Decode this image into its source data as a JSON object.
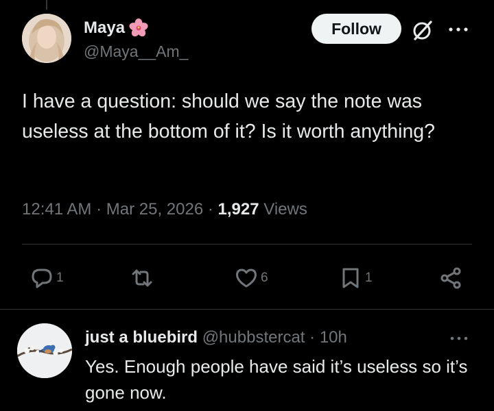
{
  "tweet": {
    "author": {
      "name": "Maya",
      "handle": "@Maya__Am_"
    },
    "follow_label": "Follow",
    "text": "I have a question: should we say the note was useless at the bottom of it? Is it worth anything?",
    "time": "12:41 AM",
    "date": "Mar 25, 2026",
    "separator": "·",
    "views_count": "1,927",
    "views_label": "Views",
    "actions": {
      "reply_count": "1",
      "like_count": "6",
      "bookmark_count": "1"
    }
  },
  "reply": {
    "author": {
      "name": "just a bluebird",
      "handle": "@hubbstercat"
    },
    "separator": "·",
    "time": "10h",
    "text": "Yes. Enough people have said it’s useless so it’s gone now."
  },
  "icons": {
    "name_emoji": "hibiscus-flower-icon",
    "grok": "grok-icon",
    "more": "more-icon",
    "reply": "reply-icon",
    "retweet": "retweet-icon",
    "like": "heart-icon",
    "bookmark": "bookmark-icon",
    "share": "share-icon"
  },
  "colors": {
    "background": "#000000",
    "primary_text": "#e7e9ea",
    "secondary_text": "#71767b",
    "divider": "#2f3336",
    "follow_bg": "#eff3f4",
    "follow_text": "#0f1419"
  }
}
